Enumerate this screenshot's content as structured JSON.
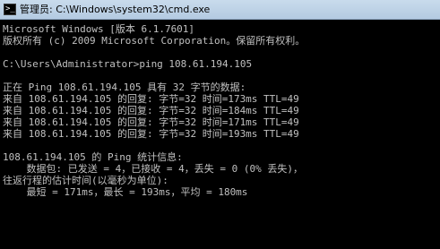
{
  "window": {
    "title": "管理员: C:\\Windows\\system32\\cmd.exe",
    "icon": "console-icon",
    "icon_glyph": ">_"
  },
  "console": {
    "lines": [
      "Microsoft Windows [版本 6.1.7601]",
      "版权所有 (c) 2009 Microsoft Corporation。保留所有权利。",
      "",
      "C:\\Users\\Administrator>ping 108.61.194.105",
      "",
      "正在 Ping 108.61.194.105 具有 32 字节的数据:",
      "来自 108.61.194.105 的回复: 字节=32 时间=173ms TTL=49",
      "来自 108.61.194.105 的回复: 字节=32 时间=184ms TTL=49",
      "来自 108.61.194.105 的回复: 字节=32 时间=171ms TTL=49",
      "来自 108.61.194.105 的回复: 字节=32 时间=193ms TTL=49",
      "",
      "108.61.194.105 的 Ping 统计信息:",
      "    数据包: 已发送 = 4，已接收 = 4，丢失 = 0 (0% 丢失)，",
      "往返行程的估计时间(以毫秒为单位):",
      "    最短 = 171ms，最长 = 193ms，平均 = 180ms"
    ]
  },
  "colors": {
    "console_text": "#c0c0c0",
    "console_background": "#000000",
    "titlebar": "#c9dbec"
  }
}
